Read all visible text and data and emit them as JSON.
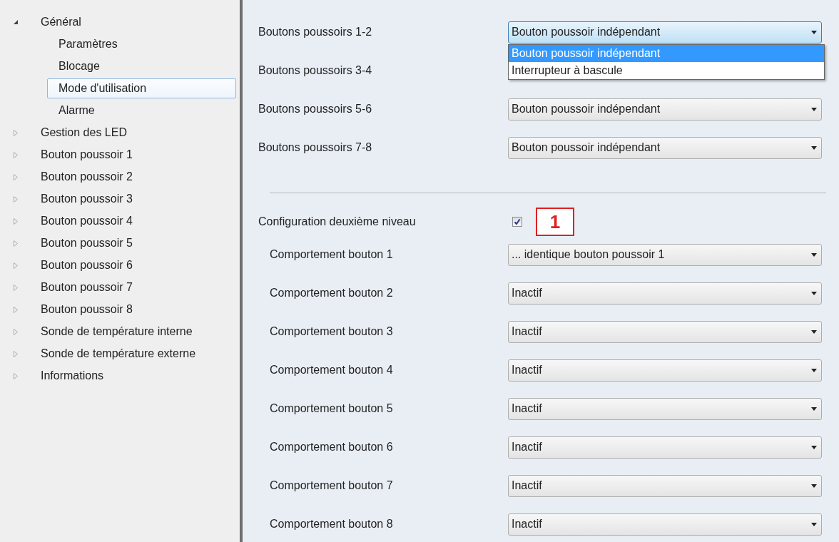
{
  "tree": [
    {
      "label": "Général",
      "expanded": true,
      "children": [
        {
          "label": "Paramètres",
          "selected": false
        },
        {
          "label": "Blocage",
          "selected": false
        },
        {
          "label": "Mode d'utilisation",
          "selected": true
        },
        {
          "label": "Alarme",
          "selected": false
        }
      ]
    },
    {
      "label": "Gestion des LED",
      "expanded": false
    },
    {
      "label": "Bouton poussoir 1",
      "expanded": false
    },
    {
      "label": "Bouton poussoir 2",
      "expanded": false
    },
    {
      "label": "Bouton poussoir 3",
      "expanded": false
    },
    {
      "label": "Bouton poussoir 4",
      "expanded": false
    },
    {
      "label": "Bouton poussoir 5",
      "expanded": false
    },
    {
      "label": "Bouton poussoir 6",
      "expanded": false
    },
    {
      "label": "Bouton poussoir 7",
      "expanded": false
    },
    {
      "label": "Bouton poussoir 8",
      "expanded": false
    },
    {
      "label": "Sonde de température interne",
      "expanded": false
    },
    {
      "label": "Sonde de température externe",
      "expanded": false
    },
    {
      "label": "Informations",
      "expanded": false
    }
  ],
  "pairs": [
    {
      "label": "Boutons poussoirs 1-2",
      "value": "Bouton poussoir indépendant",
      "focused": true,
      "open_list": [
        {
          "label": "Bouton poussoir indépendant",
          "selected": true
        },
        {
          "label": "Interrupteur à bascule",
          "selected": false
        }
      ]
    },
    {
      "label": "Boutons poussoirs 3-4"
    },
    {
      "label": "Boutons poussoirs 5-6",
      "value": "Bouton poussoir indépendant",
      "focused": false
    },
    {
      "label": "Boutons poussoirs 7-8",
      "value": "Bouton poussoir indépendant",
      "focused": false
    }
  ],
  "second_level": {
    "label": "Configuration deuxième niveau",
    "checked": true,
    "annotation": "1"
  },
  "behaviours": [
    {
      "label": "Comportement bouton 1",
      "value": "... identique bouton poussoir 1"
    },
    {
      "label": "Comportement bouton 2",
      "value": "Inactif"
    },
    {
      "label": "Comportement bouton 3",
      "value": "Inactif"
    },
    {
      "label": "Comportement bouton 4",
      "value": "Inactif"
    },
    {
      "label": "Comportement bouton 5",
      "value": "Inactif"
    },
    {
      "label": "Comportement bouton 6",
      "value": "Inactif"
    },
    {
      "label": "Comportement bouton 7",
      "value": "Inactif"
    },
    {
      "label": "Comportement bouton 8",
      "value": "Inactif"
    }
  ]
}
